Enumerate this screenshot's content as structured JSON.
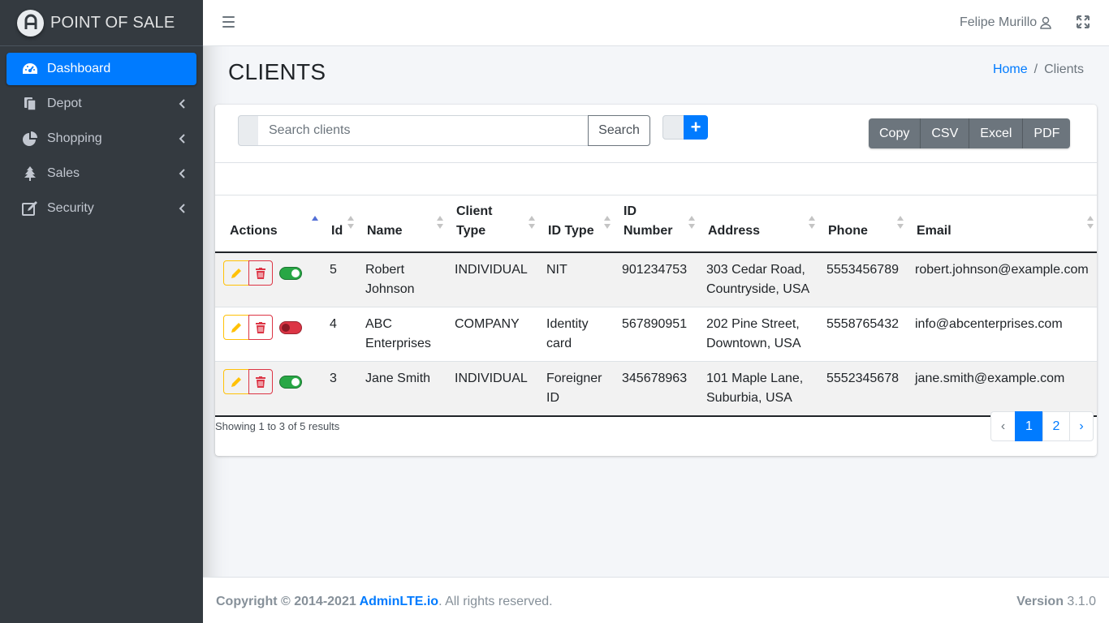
{
  "brand": {
    "name": "POINT OF SALE"
  },
  "sidebar": {
    "items": [
      {
        "label": "Dashboard",
        "icon": "tachometer-icon",
        "active": true
      },
      {
        "label": "Depot",
        "icon": "copy-icon"
      },
      {
        "label": "Shopping",
        "icon": "pie-chart-icon"
      },
      {
        "label": "Sales",
        "icon": "tree-icon"
      },
      {
        "label": "Security",
        "icon": "edit-icon"
      }
    ]
  },
  "header": {
    "user_name": "Felipe Murillo"
  },
  "page": {
    "title": "CLIENTS",
    "breadcrumb": {
      "home": "Home",
      "current": "Clients"
    }
  },
  "toolbar": {
    "search_placeholder": "Search clients",
    "search_label": "Search",
    "add_label": "+",
    "exports": [
      "Copy",
      "CSV",
      "Excel",
      "PDF"
    ]
  },
  "table": {
    "columns": [
      "Actions",
      "Id",
      "Name",
      "Client Type",
      "ID Type",
      "ID Number",
      "Address",
      "Phone",
      "Email"
    ],
    "rows": [
      {
        "id": "5",
        "name": "Robert Johnson",
        "client_type": "INDIVIDUAL",
        "id_type": "NIT",
        "id_number": "901234753",
        "address": "303 Cedar Road, Countryside, USA",
        "phone": "5553456789",
        "email": "robert.johnson@example.com",
        "active": true
      },
      {
        "id": "4",
        "name": "ABC Enterprises",
        "client_type": "COMPANY",
        "id_type": "Identity card",
        "id_number": "567890951",
        "address": "202 Pine Street, Downtown, USA",
        "phone": "5558765432",
        "email": "info@abcenterprises.com",
        "active": false
      },
      {
        "id": "3",
        "name": "Jane Smith",
        "client_type": "INDIVIDUAL",
        "id_type": "Foreigner ID",
        "id_number": "345678963",
        "address": "101 Maple Lane, Suburbia, USA",
        "phone": "5552345678",
        "email": "jane.smith@example.com",
        "active": true
      }
    ]
  },
  "pagination": {
    "summary": "Showing 1 to 3 of 5 results",
    "prev": "‹",
    "pages": [
      "1",
      "2"
    ],
    "next": "›",
    "current": "1"
  },
  "footer": {
    "copyright_prefix": "Copyright © 2014-2021 ",
    "link": "AdminLTE.io",
    "copyright_suffix": ". All rights reserved.",
    "version_label": "Version",
    "version": " 3.1.0"
  },
  "colors": {
    "primary": "#007bff",
    "sidebar_bg": "#343a40",
    "success": "#28a745",
    "danger": "#dc3545",
    "warning": "#ffc107",
    "secondary": "#6c757d"
  }
}
